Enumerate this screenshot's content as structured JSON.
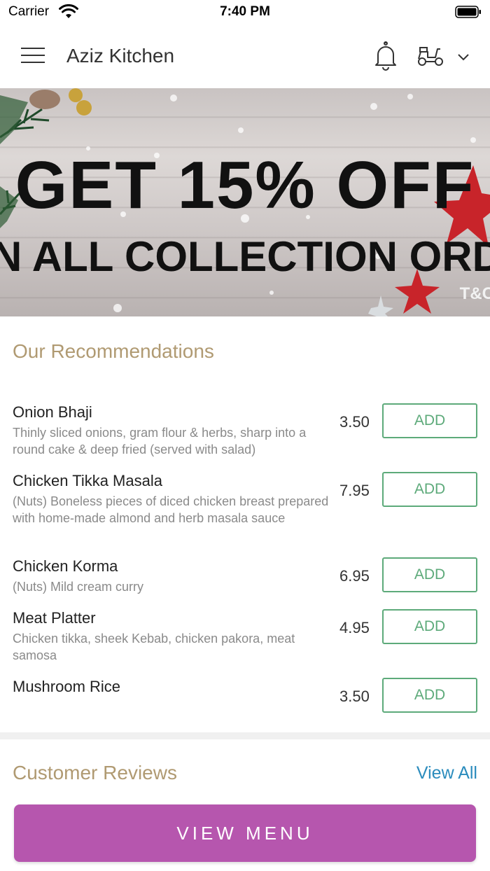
{
  "status_bar": {
    "carrier": "Carrier",
    "time": "7:40 PM"
  },
  "header": {
    "title": "Aziz Kitchen",
    "icons": [
      "menu-icon",
      "bell-icon",
      "scooter-icon",
      "chevron-down-icon"
    ]
  },
  "banner": {
    "line1": "GET 15% OFF",
    "line2": "N ALL COLLECTION ORDER",
    "tc": "T&C"
  },
  "recommendations": {
    "title": "Our Recommendations",
    "add_label": "ADD",
    "items": [
      {
        "name": "Onion Bhaji",
        "description": "Thinly sliced onions, gram flour & herbs, sharp into a round cake & deep fried (served with salad)",
        "price": "3.50"
      },
      {
        "name": "Chicken Tikka Masala",
        "description": "(Nuts) Boneless pieces of diced chicken breast prepared with home-made almond and herb masala sauce",
        "price": "7.95"
      },
      {
        "name": "Chicken Korma",
        "description": "(Nuts) Mild cream curry",
        "price": "6.95"
      },
      {
        "name": "Meat Platter",
        "description": "Chicken tikka, sheek Kebab, chicken pakora, meat samosa",
        "price": "4.95"
      },
      {
        "name": "Mushroom Rice",
        "description": "",
        "price": "3.50"
      }
    ]
  },
  "reviews": {
    "title": "Customer Reviews",
    "view_all": "View All"
  },
  "footer": {
    "view_menu": "VIEW MENU"
  },
  "colors": {
    "accent_gold": "#b09a72",
    "add_green": "#5daa7a",
    "link_blue": "#2b8cbd",
    "view_menu_purple": "#b656ae"
  }
}
